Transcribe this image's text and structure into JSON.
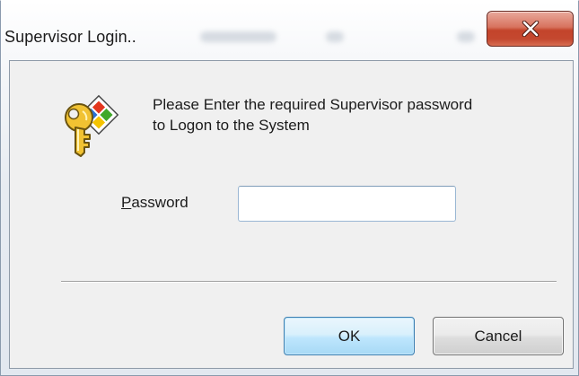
{
  "window": {
    "title": "Supervisor Login..",
    "close_icon": "close-x-icon"
  },
  "dialog": {
    "icon": "key-icon",
    "message_line1": "Please Enter the required Supervisor password",
    "message_line2": "to Logon to the System",
    "password": {
      "label": "Password",
      "value": "",
      "placeholder": ""
    }
  },
  "buttons": {
    "ok_label": "OK",
    "cancel_label": "Cancel"
  },
  "colors": {
    "close_button": "#c7452c",
    "ok_button_border": "#3c7fb1",
    "dialog_background": "#f0f0f0"
  }
}
